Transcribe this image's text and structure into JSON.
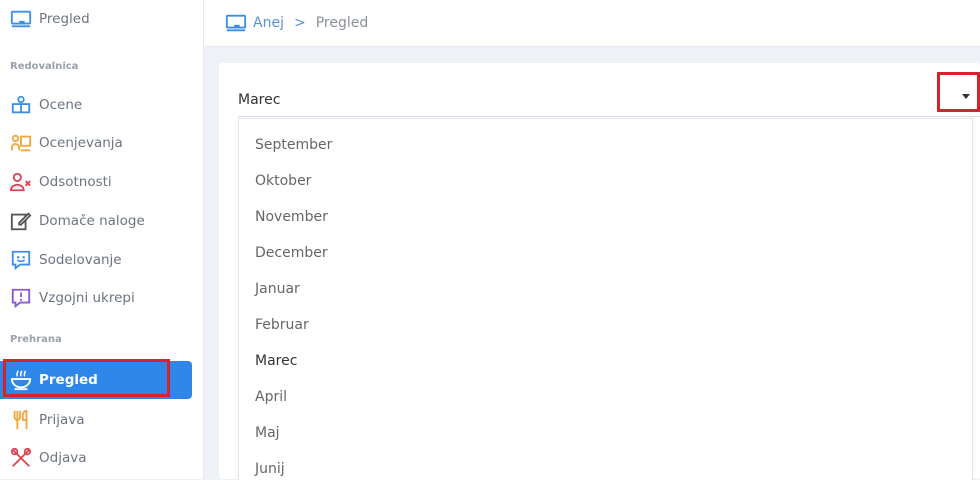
{
  "sidebar": {
    "top_item": "Pregled",
    "sections": [
      "Redovalnica",
      "Prehrana"
    ],
    "redovalnica_items": [
      {
        "label": "Ocene",
        "icon": "gradebook-icon"
      },
      {
        "label": "Ocenjevanja",
        "icon": "assessment-icon"
      },
      {
        "label": "Odsotnosti",
        "icon": "absence-icon"
      },
      {
        "label": "Domače naloge",
        "icon": "edit-icon"
      },
      {
        "label": "Sodelovanje",
        "icon": "participation-icon"
      },
      {
        "label": "Vzgojni ukrepi",
        "icon": "alert-icon"
      }
    ],
    "prehrana_items": [
      {
        "label": "Pregled",
        "icon": "bowl-icon",
        "active": true
      },
      {
        "label": "Prijava",
        "icon": "cutlery-icon"
      },
      {
        "label": "Odjava",
        "icon": "cutlery-cancel-icon"
      }
    ]
  },
  "breadcrumb": {
    "root": "Anej",
    "separator": ">",
    "current": "Pregled"
  },
  "month_select": {
    "selected": "Marec",
    "options": [
      "September",
      "Oktober",
      "November",
      "December",
      "Januar",
      "Februar",
      "Marec",
      "April",
      "Maj",
      "Junij"
    ]
  },
  "colors": {
    "accent": "#2f86e9",
    "highlight": "#d4222f",
    "icon_blue": "#3b8fe8",
    "icon_orange": "#f0a63a",
    "icon_red": "#e0414f",
    "icon_purple": "#8a58d6"
  }
}
